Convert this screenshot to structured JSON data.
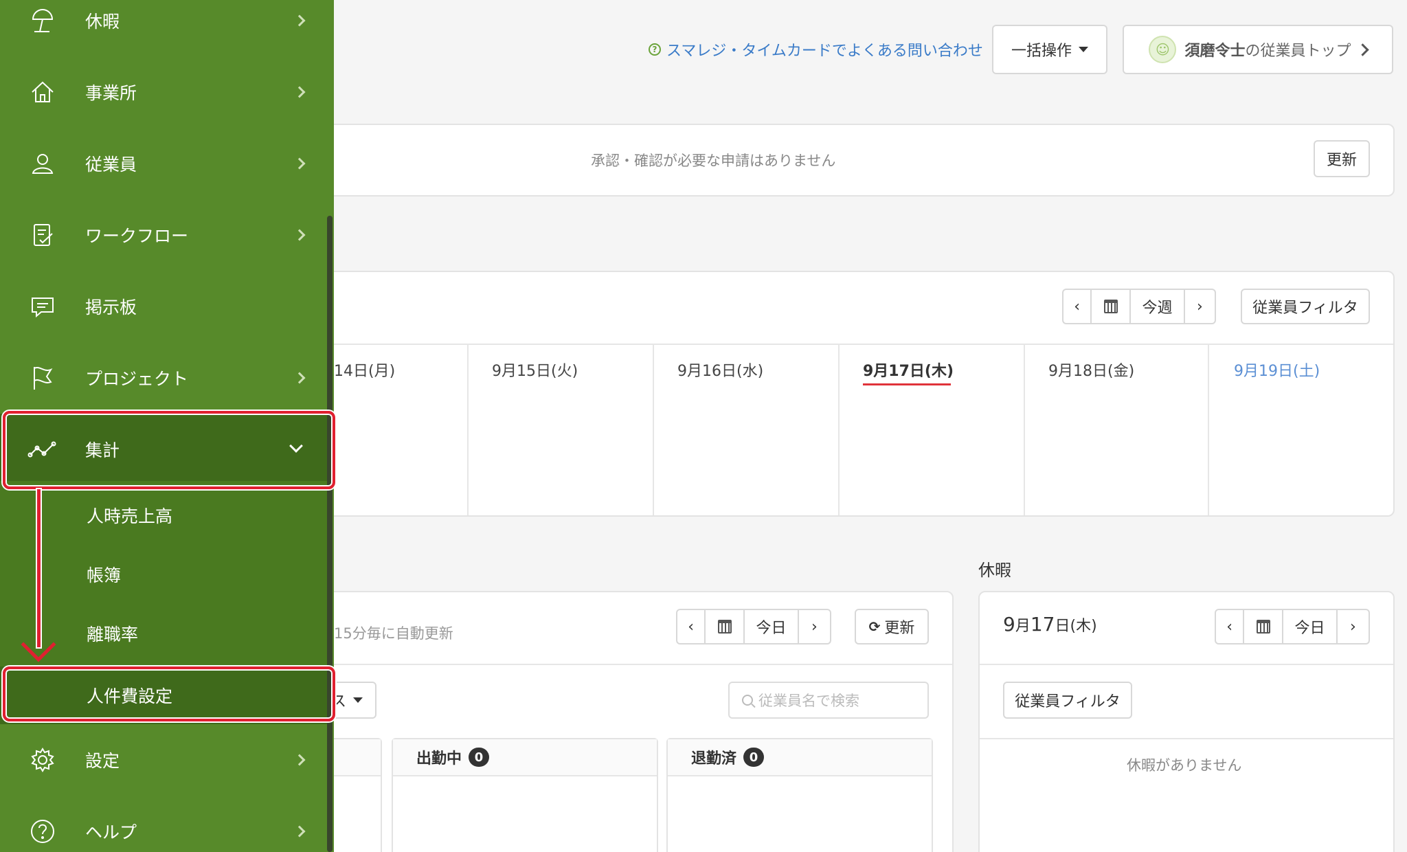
{
  "header": {
    "faq_link": "スマレジ・タイムカードでよくある問い合わせ",
    "bulk_ops": "一括操作",
    "employee_top_name": "須磨令士",
    "employee_top_suffix": "の従業員トップ"
  },
  "notice": {
    "message": "承認・確認が必要な申請はありません",
    "refresh": "更新"
  },
  "week": {
    "prev": "‹",
    "today": "今週",
    "next": "›",
    "filter": "従業員フィルタ",
    "days": [
      "14日(月)",
      "9月15日(火)",
      "9月16日(水)",
      "9月17日(木)",
      "9月18日(金)",
      "9月19日(土)"
    ],
    "today_index": 3
  },
  "attendance": {
    "auto_refresh": "15分毎に自動更新",
    "prev": "‹",
    "today": "今日",
    "next": "›",
    "refresh": "更新",
    "dropdown_partial": "ス",
    "search_placeholder": "従業員名で検索",
    "columns": [
      {
        "label": "出勤中",
        "count": "0"
      },
      {
        "label": "退勤済",
        "count": "0"
      }
    ]
  },
  "vacation": {
    "title": "休暇",
    "date_month": "9",
    "date_month_unit": "月",
    "date_day": "17",
    "date_day_unit": "日",
    "date_weekday": "(木)",
    "prev": "‹",
    "today": "今日",
    "next": "›",
    "filter": "従業員フィルタ",
    "empty": "休暇がありません"
  },
  "sidebar": {
    "items": [
      {
        "label": "休暇",
        "icon": "beach-umbrella-icon"
      },
      {
        "label": "事業所",
        "icon": "home-icon"
      },
      {
        "label": "従業員",
        "icon": "person-icon"
      },
      {
        "label": "ワークフロー",
        "icon": "checklist-icon"
      },
      {
        "label": "掲示板",
        "icon": "chat-bubble-icon"
      },
      {
        "label": "プロジェクト",
        "icon": "flag-icon"
      },
      {
        "label": "集計",
        "icon": "line-chart-icon"
      }
    ],
    "submenu": [
      "人時売上高",
      "帳簿",
      "離職率",
      "人件費設定"
    ],
    "bottom_items": [
      {
        "label": "設定",
        "icon": "gear-icon"
      },
      {
        "label": "ヘルプ",
        "icon": "question-icon"
      }
    ]
  },
  "colors": {
    "sidebar_bg": "#578a2a",
    "sidebar_active": "#3f6a1b",
    "highlight": "#e02030",
    "link": "#3a7bc8",
    "today_underline": "#e0333a"
  }
}
